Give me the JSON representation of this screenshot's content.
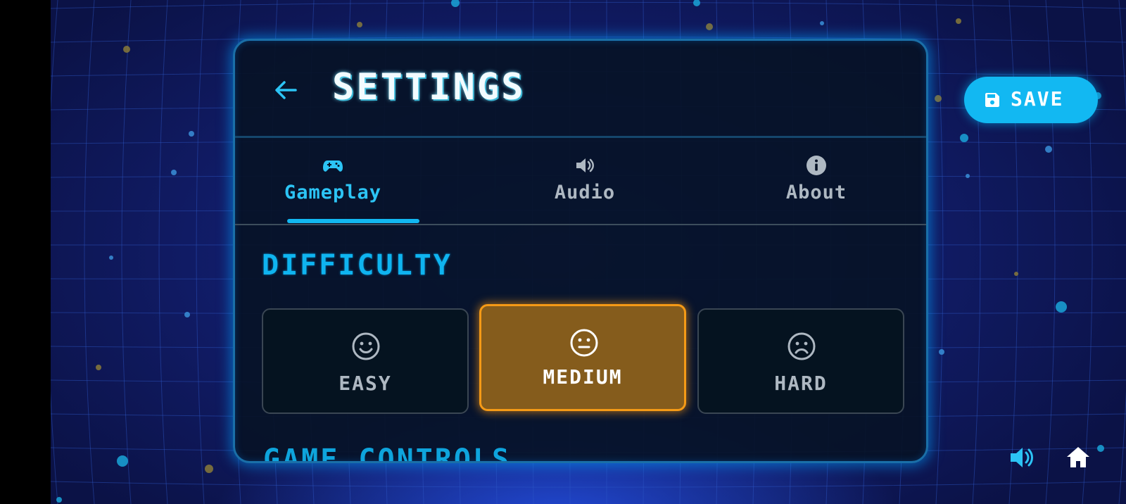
{
  "header": {
    "title": "SETTINGS",
    "back_icon": "arrow-left-icon"
  },
  "tabs": [
    {
      "label": "Gameplay",
      "icon": "gamepad-icon",
      "active": true
    },
    {
      "label": "Audio",
      "icon": "speaker-icon",
      "active": false
    },
    {
      "label": "About",
      "icon": "info-icon",
      "active": false
    }
  ],
  "difficulty": {
    "title": "DIFFICULTY",
    "options": [
      {
        "label": "EASY",
        "icon": "smile-face-icon",
        "selected": false
      },
      {
        "label": "MEDIUM",
        "icon": "neutral-face-icon",
        "selected": true
      },
      {
        "label": "HARD",
        "icon": "sad-face-icon",
        "selected": false
      }
    ]
  },
  "next_section": {
    "title": "GAME CONTROLS"
  },
  "save_button": {
    "label": "SAVE",
    "icon": "floppy-disk-icon"
  },
  "footer": {
    "sound_icon": "speaker-icon",
    "home_icon": "home-icon"
  },
  "colors": {
    "accent": "#12b8f2",
    "selected": "#855c1c",
    "selected_border": "#f59a16",
    "panel_bg": "#061226",
    "background": "#121e6e"
  }
}
